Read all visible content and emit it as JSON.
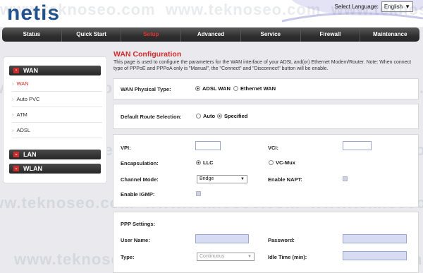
{
  "header": {
    "logo": "netis",
    "language_label": "Select Language:",
    "language_value": "English"
  },
  "nav": [
    "Status",
    "Quick Start",
    "Setup",
    "Advanced",
    "Service",
    "Firewall",
    "Maintenance"
  ],
  "sidebar": {
    "wan_heading": "WAN",
    "wan_items": [
      "WAN",
      "Auto PVC",
      "ATM",
      "ADSL"
    ],
    "lan_heading": "LAN",
    "wlan_heading": "WLAN"
  },
  "main": {
    "title": "WAN Configuration",
    "description": "This page is used to configure the parameters for the WAN interface of your ADSL and(or) Ethernet Modem/Router. Note: When connect type of PPPoE and PPPoA only is \"Manual\", the \"Connect\" and \"Disconnect\" button will be enable."
  },
  "physical": {
    "label": "WAN Physical Type:",
    "opt_adsl": "ADSL WAN",
    "opt_eth": "Ethernet WAN",
    "selected": "ADSL WAN"
  },
  "route": {
    "label": "Default Route Selection:",
    "opt_auto": "Auto",
    "opt_specified": "Specified",
    "selected": "Specified"
  },
  "atm": {
    "vpi_label": "VPI:",
    "vci_label": "VCI:",
    "encap_label": "Encapsulation:",
    "encap_llc": "LLC",
    "encap_vcmux": "VC-Mux",
    "encap_selected": "LLC",
    "channel_label": "Channel Mode:",
    "channel_value": "Bridge",
    "napt_label": "Enable NAPT:",
    "igmp_label": "Enable IGMP:"
  },
  "ppp": {
    "heading": "PPP Settings:",
    "username_label": "User Name:",
    "password_label": "Password:",
    "type_label": "Type:",
    "type_value": "Continuous",
    "idle_label": "Idle Time (min):"
  },
  "watermark": "www.teknoseo.com",
  "colors": {
    "accent": "#d12a2a",
    "logo": "#1d4f8c",
    "nav": "#2f2f2f"
  }
}
